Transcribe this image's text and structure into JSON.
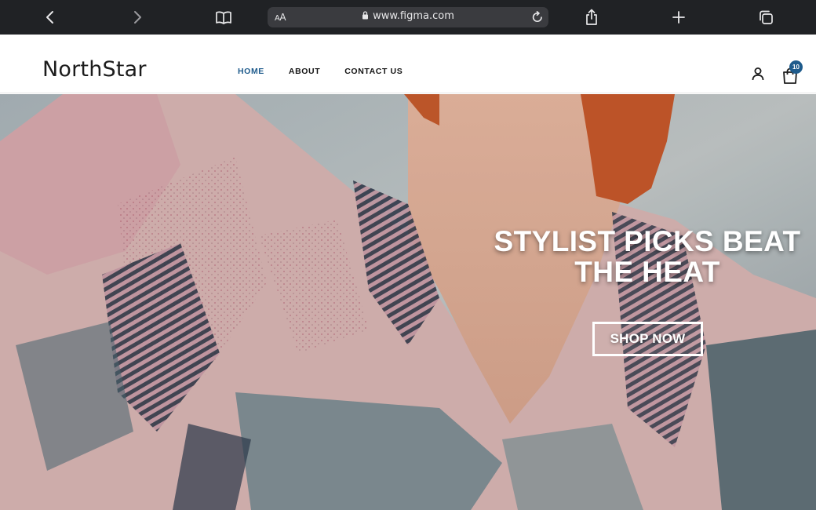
{
  "browser": {
    "url": "www.figma.com",
    "text_size_label_large": "A",
    "text_size_label_small": "A",
    "icons": [
      "back-icon",
      "forward-icon",
      "bookmarks-icon",
      "share-icon",
      "new-tab-icon",
      "tabs-icon",
      "lock-icon",
      "reload-icon"
    ]
  },
  "site": {
    "logo": "NorthStar",
    "nav": [
      {
        "label": "HOME",
        "active": true
      },
      {
        "label": "ABOUT",
        "active": false
      },
      {
        "label": "CONTACT US",
        "active": false
      }
    ],
    "cart_count": "10",
    "accent_color": "#1e5b8c"
  },
  "hero": {
    "title_line1": "STYLIST PICKS BEAT",
    "title_line2": "THE HEAT",
    "cta_label": "SHOP NOW"
  }
}
